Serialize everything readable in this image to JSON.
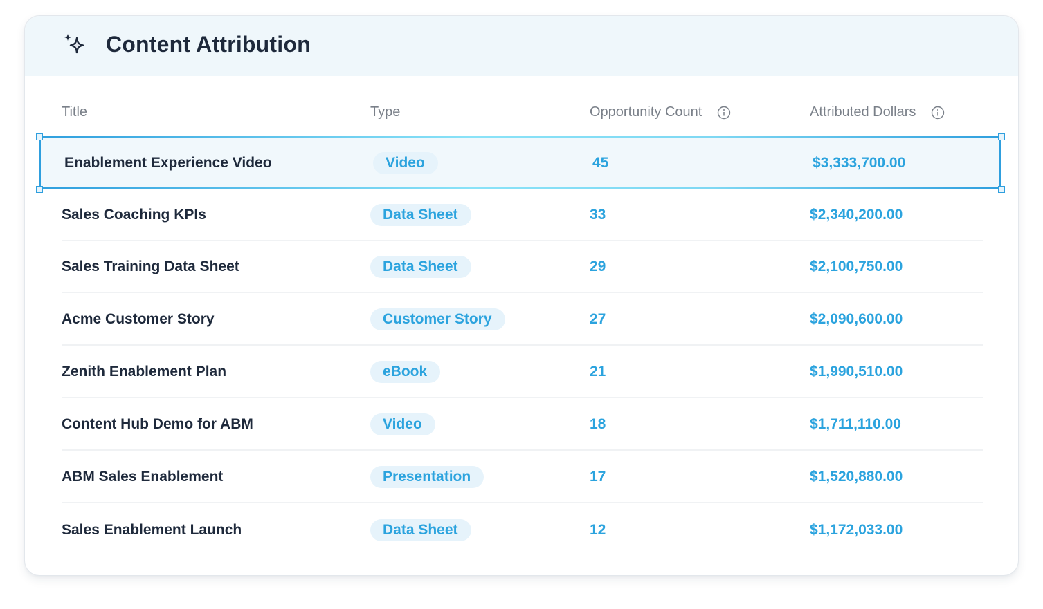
{
  "card": {
    "title": "Content Attribution",
    "icon": "sparkle-icon"
  },
  "columns": [
    {
      "label": "Title"
    },
    {
      "label": "Type"
    },
    {
      "label": "Opportunity Count",
      "info_icon": "info-icon"
    },
    {
      "label": "Attributed Dollars",
      "info_icon": "info-icon"
    }
  ],
  "rows": [
    {
      "title": "Enablement Experience Video",
      "type": "Video",
      "count": "45",
      "dollars": "$3,333,700.00",
      "selected": true
    },
    {
      "title": "Sales Coaching KPIs",
      "type": "Data Sheet",
      "count": "33",
      "dollars": "$2,340,200.00"
    },
    {
      "title": "Sales Training Data Sheet",
      "type": "Data Sheet",
      "count": "29",
      "dollars": "$2,100,750.00"
    },
    {
      "title": "Acme Customer Story",
      "type": "Customer Story",
      "count": "27",
      "dollars": "$2,090,600.00"
    },
    {
      "title": "Zenith Enablement Plan",
      "type": "eBook",
      "count": "21",
      "dollars": "$1,990,510.00"
    },
    {
      "title": "Content Hub Demo for ABM",
      "type": "Video",
      "count": "18",
      "dollars": "$1,711,110.00"
    },
    {
      "title": "ABM Sales Enablement",
      "type": "Presentation",
      "count": "17",
      "dollars": "$1,520,880.00"
    },
    {
      "title": "Sales Enablement Launch",
      "type": "Data Sheet",
      "count": "12",
      "dollars": "$1,172,033.00"
    }
  ],
  "colors": {
    "accent": "#2ba3de",
    "badge_bg": "#e6f3fb",
    "header_bg": "#eff7fb",
    "title_text": "#1e293b",
    "column_header_text": "#7a8089",
    "selection_border": "#2f9fde"
  }
}
